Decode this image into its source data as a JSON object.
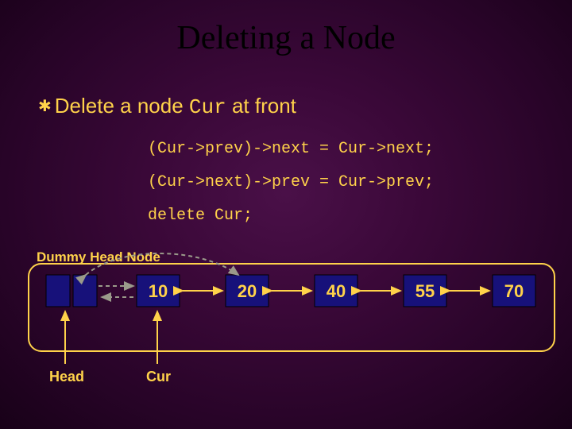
{
  "title": "Deleting a Node",
  "bullet": {
    "lead": "Delete",
    "mid": " a node ",
    "code": "Cur",
    "tail": " at front"
  },
  "code_lines": {
    "l1": "(Cur->prev)->next = Cur->next;",
    "l2": "(Cur->next)->prev = Cur->prev;",
    "l3": "delete Cur;"
  },
  "diagram": {
    "dummy_label": "Dummy Head Node",
    "nodes": [
      {
        "value": "10"
      },
      {
        "value": "20"
      },
      {
        "value": "40"
      },
      {
        "value": "55"
      },
      {
        "value": "70"
      }
    ],
    "head_label": "Head",
    "cur_label": "Cur"
  },
  "chart_data": {
    "type": "diagram",
    "structure": "doubly-linked-list-with-dummy-head",
    "operation": "delete-front-node",
    "nodes": [
      "dummy",
      "10",
      "20",
      "40",
      "55",
      "70"
    ],
    "pointers": {
      "Head": "dummy",
      "Cur": "10"
    },
    "wraparound": true,
    "deleted_node": "10",
    "new_links_after_delete": [
      [
        "dummy",
        "20"
      ],
      [
        "20",
        "dummy-prev-direction"
      ]
    ]
  }
}
